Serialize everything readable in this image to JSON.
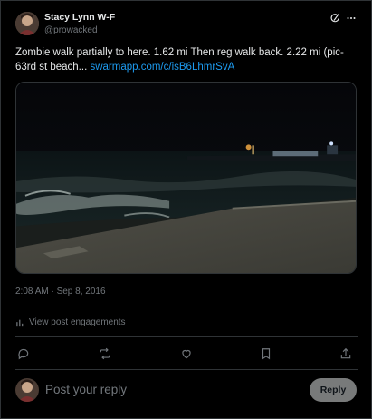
{
  "post": {
    "author_name": "Stacy Lynn W-F",
    "author_handle": "@prowacked",
    "text_main": "Zombie walk partially to here. 1.62 mi Then reg walk back. 2.22 mi (pic- 63rd st beach... ",
    "text_link": "swarmapp.com/c/isB6LhmrSvA",
    "timestamp": "2:08 AM · Sep 8, 2016",
    "engagements_label": "View post engagements",
    "media_icon": "night-beach-photo"
  },
  "header_icons": [
    "grok-icon",
    "more-icon"
  ],
  "actions": [
    "reply-icon",
    "retweet-icon",
    "like-icon",
    "bookmark-icon",
    "share-icon"
  ],
  "reply": {
    "placeholder": "Post your reply",
    "button_label": "Reply"
  },
  "colors": {
    "background": "#000000",
    "text": "#e7e9ea",
    "muted": "#71767b",
    "link": "#1d9bf0",
    "divider": "#2f3336",
    "reply_button": "#787a7a"
  }
}
